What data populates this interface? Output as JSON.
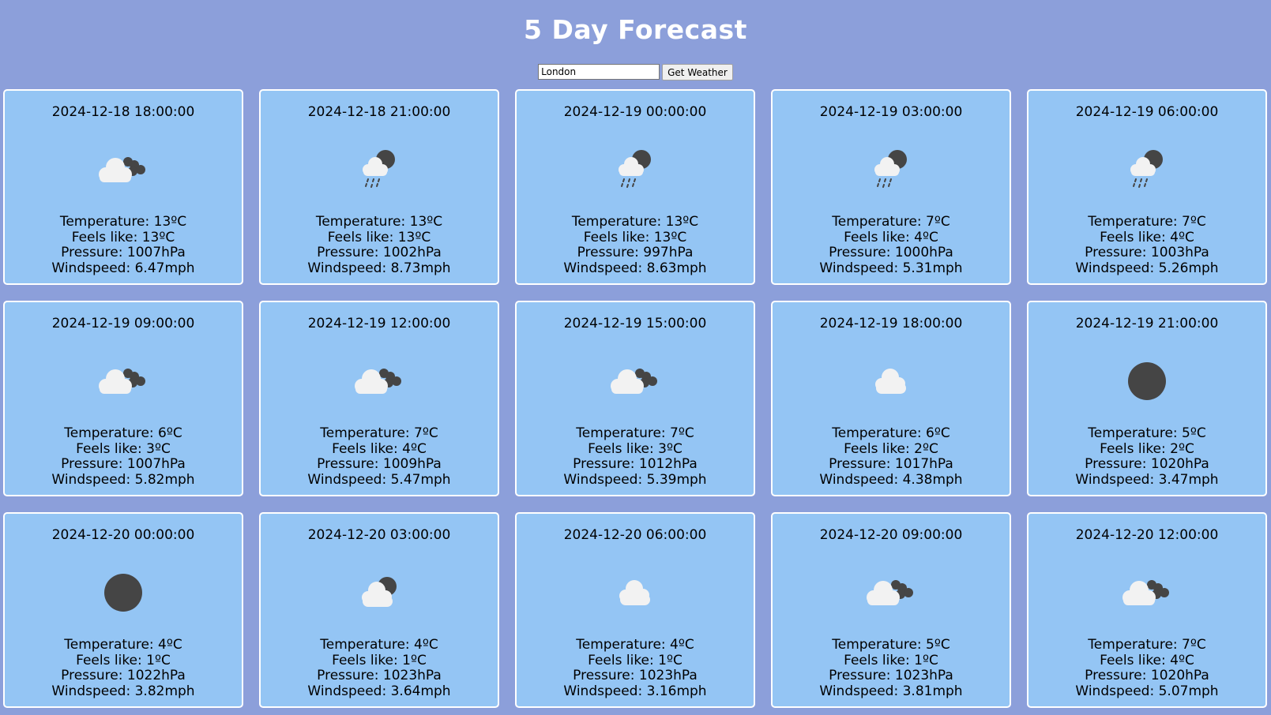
{
  "page": {
    "title": "5 Day Forecast",
    "search_value": "London",
    "button_label": "Get Weather"
  },
  "colors": {
    "background": "#8c9fda",
    "card": "#94c5f4",
    "cloud": "#f2f2f2",
    "dark": "#454545"
  },
  "forecasts": [
    {
      "date": "2024-12-18 18:00:00",
      "icon": "broken-clouds-icon",
      "temperature": "Temperature: 13ºC",
      "feels_like": "Feels like: 13ºC",
      "pressure": "Pressure: 1007hPa",
      "windspeed": "Windspeed: 6.47mph"
    },
    {
      "date": "2024-12-18 21:00:00",
      "icon": "rain-night-icon",
      "temperature": "Temperature: 13ºC",
      "feels_like": "Feels like: 13ºC",
      "pressure": "Pressure: 1002hPa",
      "windspeed": "Windspeed: 8.73mph"
    },
    {
      "date": "2024-12-19 00:00:00",
      "icon": "rain-night-icon",
      "temperature": "Temperature: 13ºC",
      "feels_like": "Feels like: 13ºC",
      "pressure": "Pressure: 997hPa",
      "windspeed": "Windspeed: 8.63mph"
    },
    {
      "date": "2024-12-19 03:00:00",
      "icon": "rain-night-icon",
      "temperature": "Temperature: 7ºC",
      "feels_like": "Feels like: 4ºC",
      "pressure": "Pressure: 1000hPa",
      "windspeed": "Windspeed: 5.31mph"
    },
    {
      "date": "2024-12-19 06:00:00",
      "icon": "rain-night-icon",
      "temperature": "Temperature: 7ºC",
      "feels_like": "Feels like: 4ºC",
      "pressure": "Pressure: 1003hPa",
      "windspeed": "Windspeed: 5.26mph"
    },
    {
      "date": "2024-12-19 09:00:00",
      "icon": "broken-clouds-icon",
      "temperature": "Temperature: 6ºC",
      "feels_like": "Feels like: 3ºC",
      "pressure": "Pressure: 1007hPa",
      "windspeed": "Windspeed: 5.82mph"
    },
    {
      "date": "2024-12-19 12:00:00",
      "icon": "broken-clouds-icon",
      "temperature": "Temperature: 7ºC",
      "feels_like": "Feels like: 4ºC",
      "pressure": "Pressure: 1009hPa",
      "windspeed": "Windspeed: 5.47mph"
    },
    {
      "date": "2024-12-19 15:00:00",
      "icon": "broken-clouds-icon",
      "temperature": "Temperature: 7ºC",
      "feels_like": "Feels like: 3ºC",
      "pressure": "Pressure: 1012hPa",
      "windspeed": "Windspeed: 5.39mph"
    },
    {
      "date": "2024-12-19 18:00:00",
      "icon": "cloud-icon",
      "temperature": "Temperature: 6ºC",
      "feels_like": "Feels like: 2ºC",
      "pressure": "Pressure: 1017hPa",
      "windspeed": "Windspeed: 4.38mph"
    },
    {
      "date": "2024-12-19 21:00:00",
      "icon": "clear-night-icon",
      "temperature": "Temperature: 5ºC",
      "feels_like": "Feels like: 2ºC",
      "pressure": "Pressure: 1020hPa",
      "windspeed": "Windspeed: 3.47mph"
    },
    {
      "date": "2024-12-20 00:00:00",
      "icon": "clear-night-icon",
      "temperature": "Temperature: 4ºC",
      "feels_like": "Feels like: 1ºC",
      "pressure": "Pressure: 1022hPa",
      "windspeed": "Windspeed: 3.82mph"
    },
    {
      "date": "2024-12-20 03:00:00",
      "icon": "cloud-night-icon",
      "temperature": "Temperature: 4ºC",
      "feels_like": "Feels like: 1ºC",
      "pressure": "Pressure: 1023hPa",
      "windspeed": "Windspeed: 3.64mph"
    },
    {
      "date": "2024-12-20 06:00:00",
      "icon": "cloud-icon",
      "temperature": "Temperature: 4ºC",
      "feels_like": "Feels like: 1ºC",
      "pressure": "Pressure: 1023hPa",
      "windspeed": "Windspeed: 3.16mph"
    },
    {
      "date": "2024-12-20 09:00:00",
      "icon": "broken-clouds-icon",
      "temperature": "Temperature: 5ºC",
      "feels_like": "Feels like: 1ºC",
      "pressure": "Pressure: 1023hPa",
      "windspeed": "Windspeed: 3.81mph"
    },
    {
      "date": "2024-12-20 12:00:00",
      "icon": "broken-clouds-icon",
      "temperature": "Temperature: 7ºC",
      "feels_like": "Feels like: 4ºC",
      "pressure": "Pressure: 1020hPa",
      "windspeed": "Windspeed: 5.07mph"
    }
  ]
}
